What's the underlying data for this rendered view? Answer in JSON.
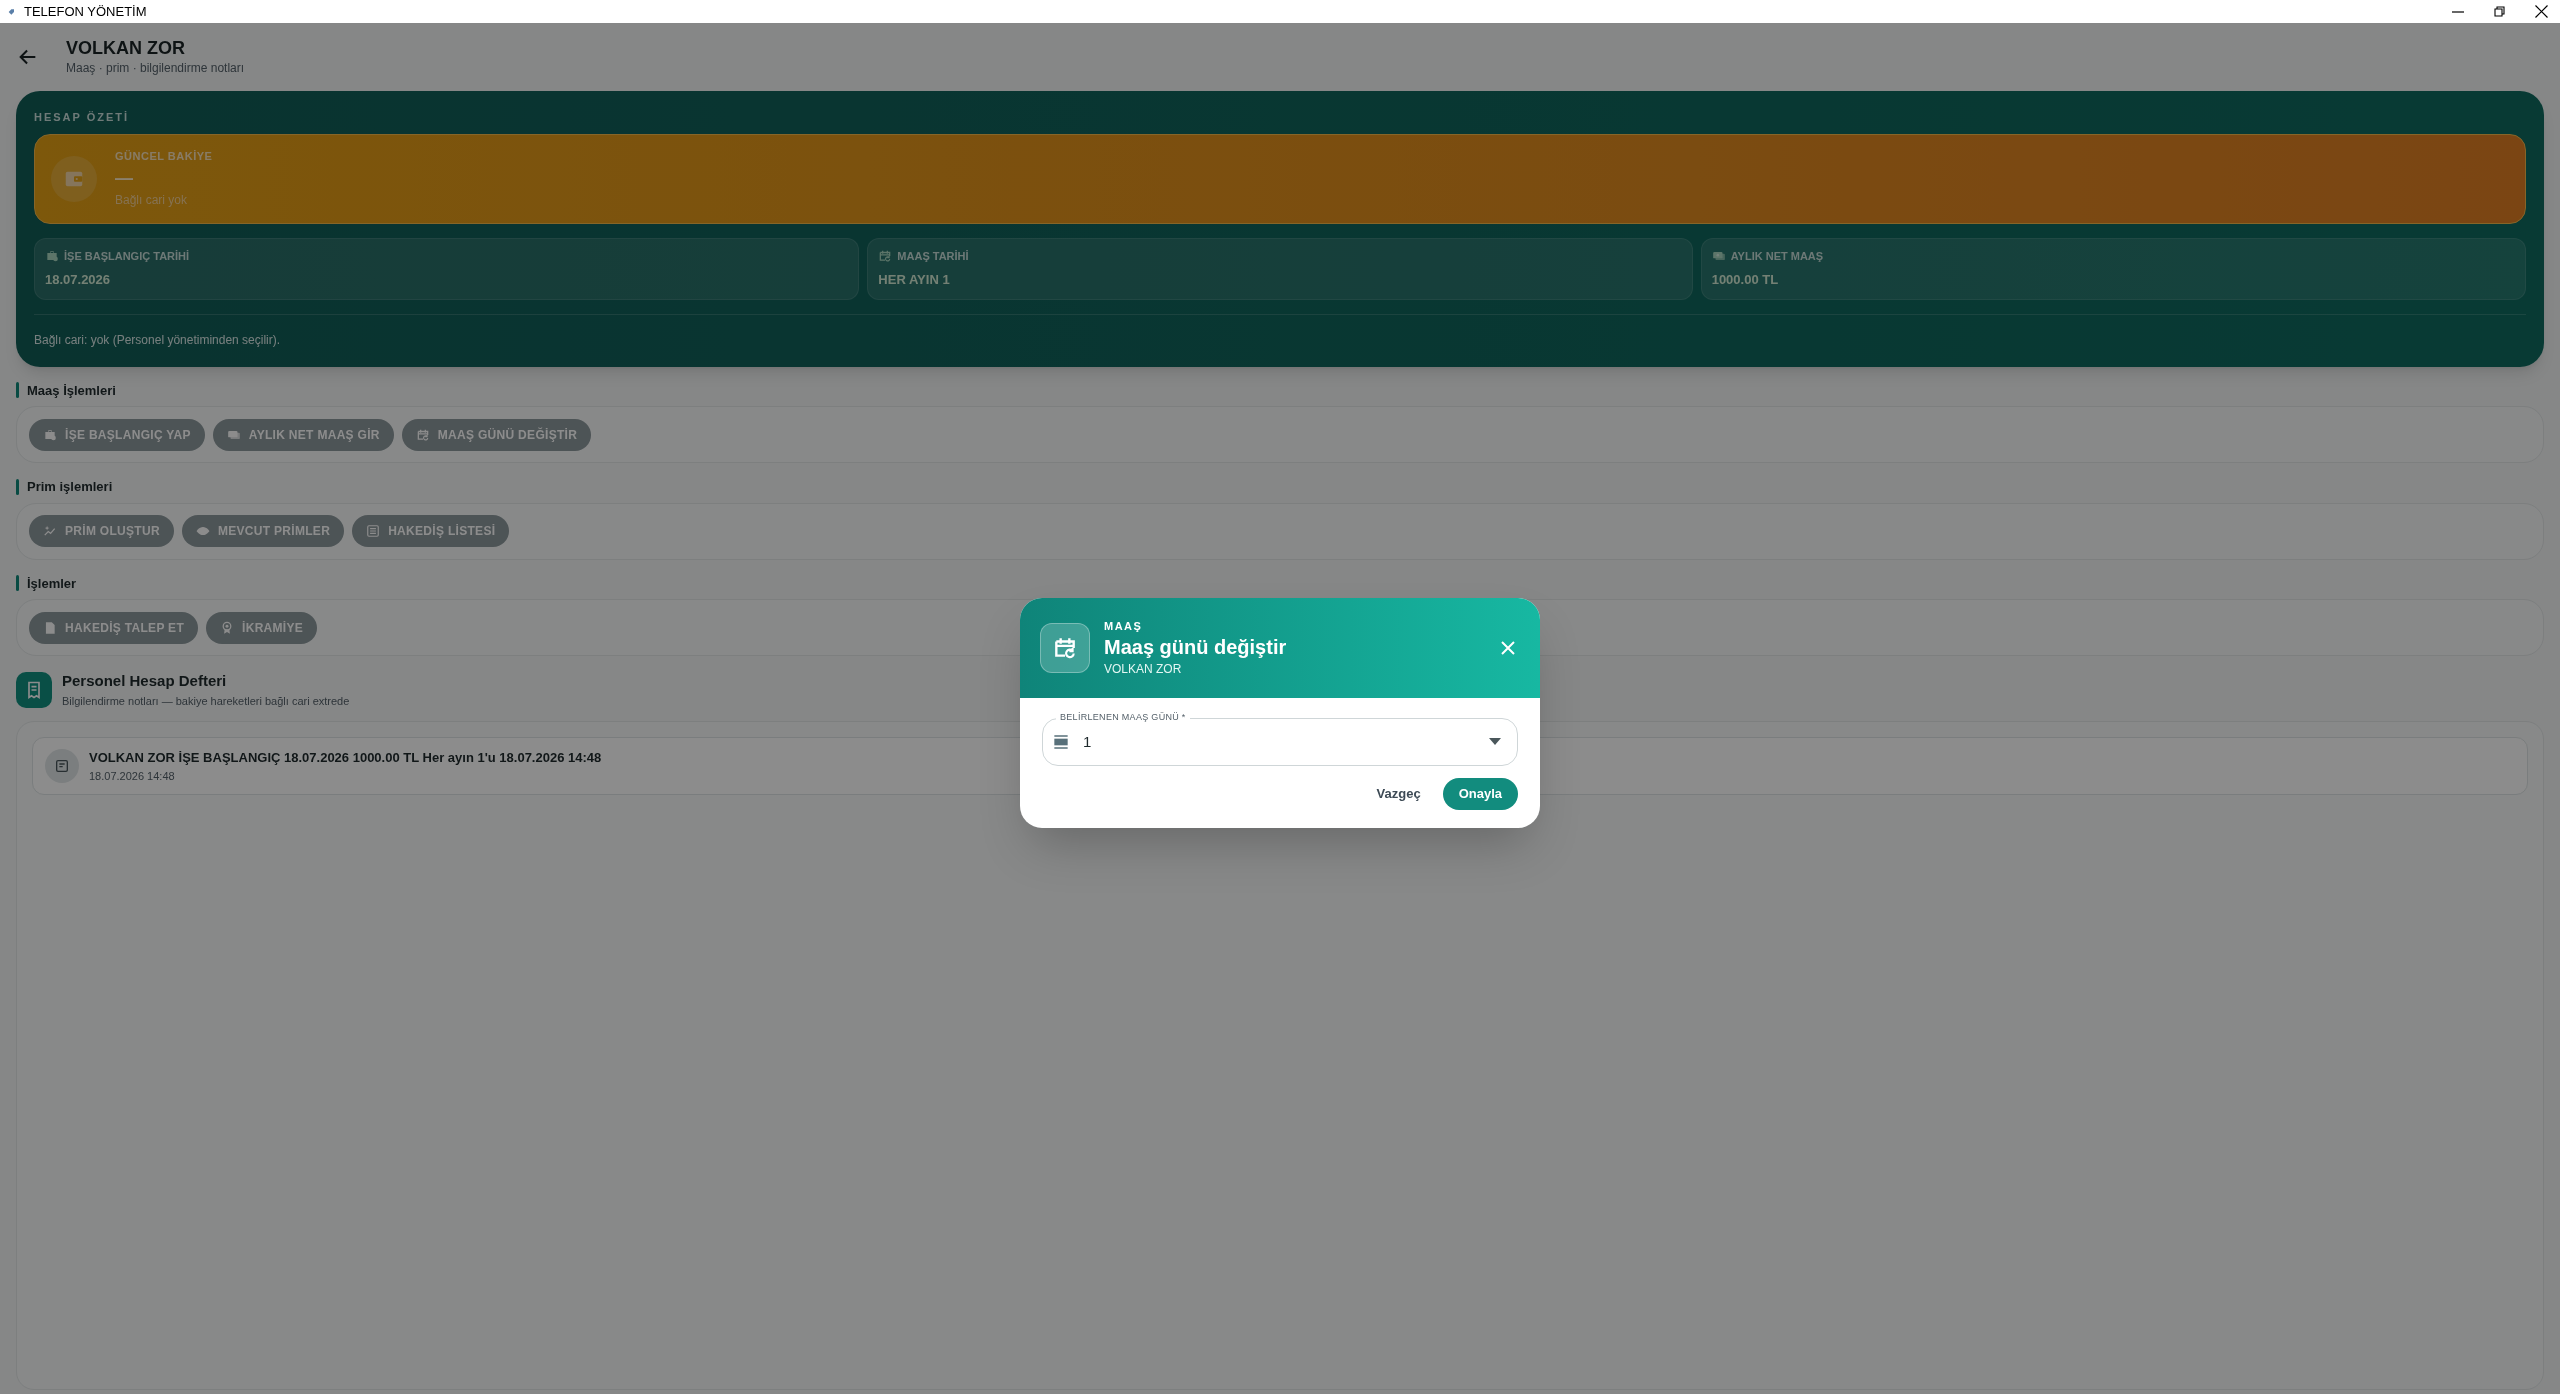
{
  "window": {
    "title": "TELEFON YÖNETİM"
  },
  "header": {
    "title": "VOLKAN ZOR",
    "subtitle": "Maaş · prim · bilgilendirme notları"
  },
  "summary": {
    "heading": "HESAP ÖZETİ",
    "balance": {
      "label": "GÜNCEL BAKİYE",
      "value": "—",
      "note": "Bağlı cari yok"
    },
    "stats": [
      {
        "label": "İŞE BAŞLANGIÇ TARİHİ",
        "value": "18.07.2026"
      },
      {
        "label": "MAAŞ TARİHİ",
        "value": "HER AYIN 1"
      },
      {
        "label": "AYLIK NET MAAŞ",
        "value": "1000.00 TL"
      }
    ],
    "footer": "Bağlı cari: yok (Personel yönetiminden seçilir)."
  },
  "sections": [
    {
      "title": "Maaş İşlemleri",
      "buttons": [
        "İŞE BAŞLANGIÇ YAP",
        "AYLIK NET MAAŞ GİR",
        "MAAŞ GÜNÜ DEĞİŞTİR"
      ]
    },
    {
      "title": "Prim işlemleri",
      "buttons": [
        "PRİM OLUŞTUR",
        "MEVCUT PRİMLER",
        "HAKEDİŞ LİSTESİ"
      ]
    },
    {
      "title": "İşlemler",
      "buttons": [
        "HAKEDİŞ TALEP ET",
        "İKRAMİYE"
      ]
    }
  ],
  "ledger": {
    "title": "Personel Hesap Defteri",
    "subtitle": "Bilgilendirme notları — bakiye hareketleri bağlı cari extrede",
    "entries": [
      {
        "text": "VOLKAN ZOR İŞE BAŞLANGIÇ 18.07.2026 1000.00 TL Her ayın 1'u 18.07.2026 14:48",
        "time": "18.07.2026 14:48"
      }
    ]
  },
  "dialog": {
    "overline": "MAAŞ",
    "title": "Maaş günü değiştir",
    "subtitle": "VOLKAN ZOR",
    "field": {
      "label": "BELİRLENEN MAAŞ GÜNÜ *",
      "value": "1"
    },
    "buttons": [
      {
        "label": "Vazgeç",
        "kind": "text"
      },
      {
        "label": "Onayla",
        "kind": "primary"
      }
    ]
  }
}
